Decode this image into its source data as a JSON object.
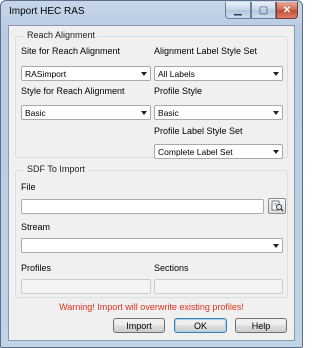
{
  "window": {
    "title": "Import HEC RAS"
  },
  "reach_alignment": {
    "group_label": "Reach Alignment",
    "site_label": "Site for Reach Alignment",
    "site_value": "RASimport",
    "align_label_style_label": "Alignment Label Style Set",
    "align_label_style_value": "All Labels",
    "style_label": "Style for Reach Alignment",
    "style_value": "Basic",
    "profile_style_label": "Profile Style",
    "profile_style_value": "Basic",
    "profile_label_style_label": "Profile Label Style Set",
    "profile_label_style_value": "Complete Label Set"
  },
  "sdf": {
    "group_label": "SDF To Import",
    "file_label": "File",
    "file_value": "",
    "stream_label": "Stream",
    "stream_value": "",
    "profiles_label": "Profiles",
    "profiles_value": "",
    "sections_label": "Sections",
    "sections_value": ""
  },
  "warning": "Warning!  Import will overwrite existing profiles!",
  "buttons": {
    "import": "Import",
    "ok": "OK",
    "help": "Help"
  }
}
